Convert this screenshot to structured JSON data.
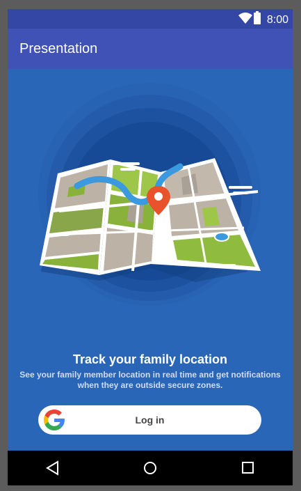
{
  "status_bar": {
    "time": "8:00",
    "icons": [
      "wifi-icon",
      "battery-icon"
    ]
  },
  "app_bar": {
    "title": "Presentation"
  },
  "colors": {
    "app_bar": "#4052b5",
    "status_bar": "#3547a4",
    "background": "#2a66b8",
    "accent_pin": "#e8532b"
  },
  "illustration": {
    "icon": "folded-map-with-location-pin"
  },
  "onboarding": {
    "headline": "Track your family location",
    "description": "See your family member location in real time and get notifications when they are outside secure zones."
  },
  "login_button": {
    "label": "Log in",
    "icon": "google-g-icon"
  },
  "nav_bar": {
    "back": "back-icon",
    "home": "home-icon",
    "recents": "recents-icon"
  }
}
